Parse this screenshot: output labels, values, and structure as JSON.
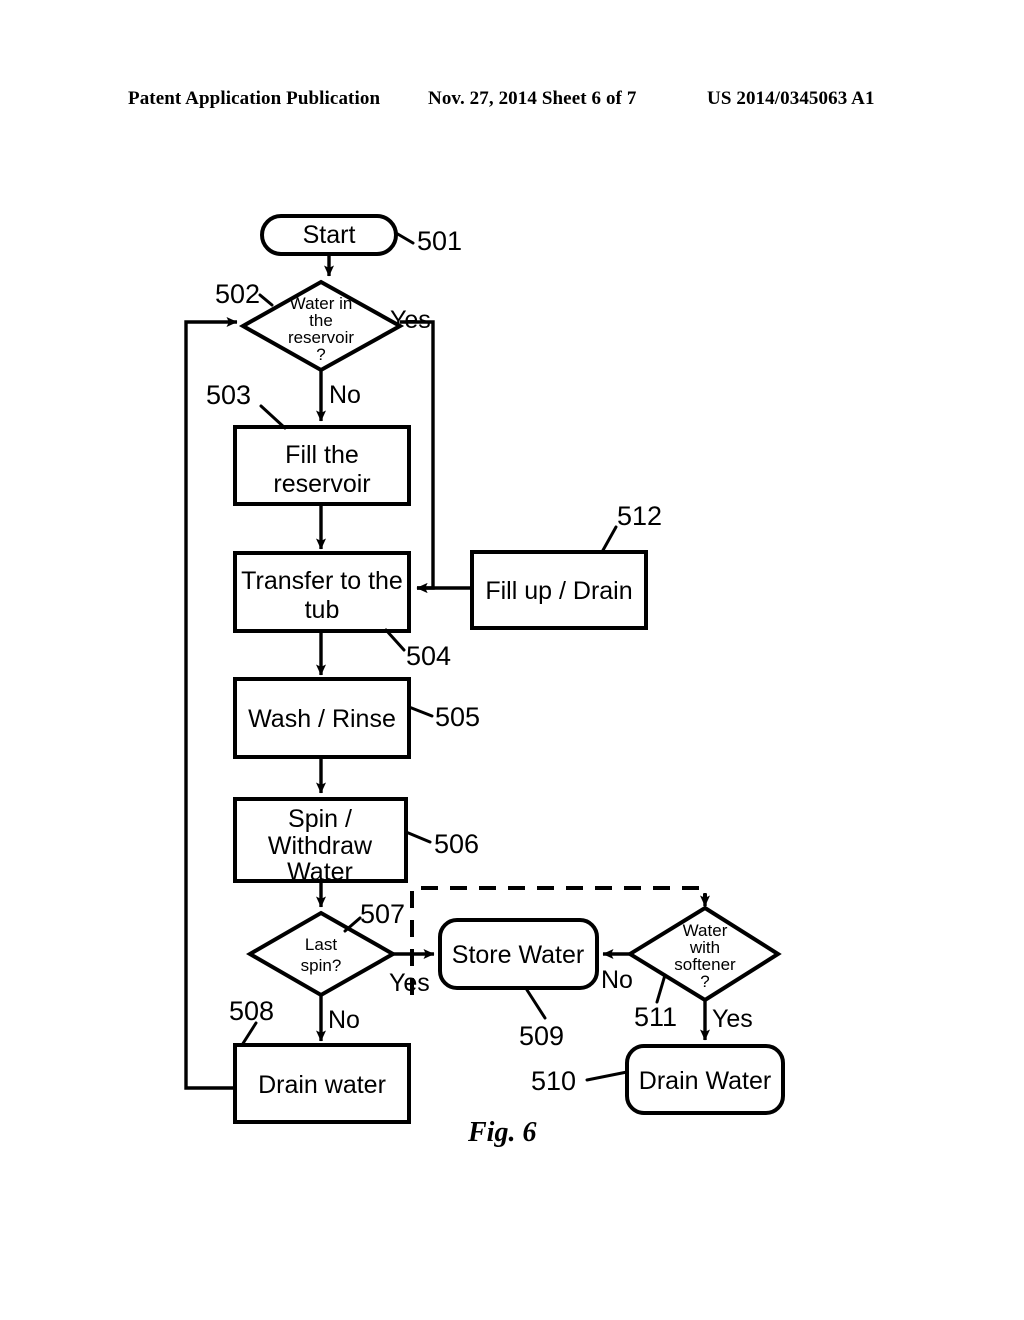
{
  "header": {
    "left": "Patent Application Publication",
    "middle": "Nov. 27, 2014  Sheet 6 of 7",
    "right": "US 2014/0345063 A1"
  },
  "figure": {
    "caption": "Fig. 6",
    "type": "flowchart",
    "nodes": [
      {
        "ref": "501",
        "shape": "stadium",
        "label": "Start"
      },
      {
        "ref": "502",
        "shape": "diamond",
        "label_lines": [
          "Water in",
          "the",
          "reservoir",
          "?"
        ]
      },
      {
        "ref": "503",
        "shape": "rect",
        "label_lines": [
          "Fill the",
          "reservoir"
        ]
      },
      {
        "ref": "504",
        "shape": "rect",
        "label_lines": [
          "Transfer to the",
          "tub"
        ]
      },
      {
        "ref": "505",
        "shape": "rect",
        "label_lines": [
          "Wash / Rinse"
        ]
      },
      {
        "ref": "506",
        "shape": "rect",
        "label_lines": [
          "Spin /",
          "Withdraw",
          "Water"
        ]
      },
      {
        "ref": "507",
        "shape": "diamond",
        "label_lines": [
          "Last",
          "spin?"
        ]
      },
      {
        "ref": "508",
        "shape": "rect",
        "label_lines": [
          "Drain water"
        ]
      },
      {
        "ref": "509",
        "shape": "stadium",
        "label_lines": [
          "Store Water"
        ]
      },
      {
        "ref": "510",
        "shape": "stadium",
        "label_lines": [
          "Drain Water"
        ]
      },
      {
        "ref": "511",
        "shape": "diamond",
        "label_lines": [
          "Water",
          "with",
          "softener",
          "?"
        ]
      },
      {
        "ref": "512",
        "shape": "rect",
        "label_lines": [
          "Fill up / Drain"
        ]
      }
    ],
    "branch_labels": {
      "d502_yes": "Yes",
      "d502_no": "No",
      "d507_yes": "Yes",
      "d507_no": "No",
      "d511_yes": "Yes",
      "d511_no": "No"
    },
    "ref_numbers": {
      "n501": "501",
      "n502": "502",
      "n503": "503",
      "n504": "504",
      "n505": "505",
      "n506": "506",
      "n507": "507",
      "n508": "508",
      "n509": "509",
      "n510": "510",
      "n511": "511",
      "n512": "512"
    },
    "node_text": {
      "start": "Start",
      "d502_l1": "Water in",
      "d502_l2": "the",
      "d502_l3": "reservoir",
      "d502_l4": "?",
      "fill_reservoir_l1": "Fill the",
      "fill_reservoir_l2": "reservoir",
      "transfer_l1": "Transfer to the",
      "transfer_l2": "tub",
      "wash_rinse": "Wash / Rinse",
      "spin_l1": "Spin /",
      "spin_l2": "Withdraw",
      "spin_l3": "Water",
      "d507_l1": "Last",
      "d507_l2": "spin?",
      "drain_water_508": "Drain water",
      "store_water": "Store Water",
      "drain_water_510": "Drain Water",
      "d511_l1": "Water",
      "d511_l2": "with",
      "d511_l3": "softener",
      "d511_l4": "?",
      "fill_up_drain": "Fill up / Drain"
    },
    "colors": {
      "ink": "#000000",
      "paper": "#ffffff"
    }
  }
}
